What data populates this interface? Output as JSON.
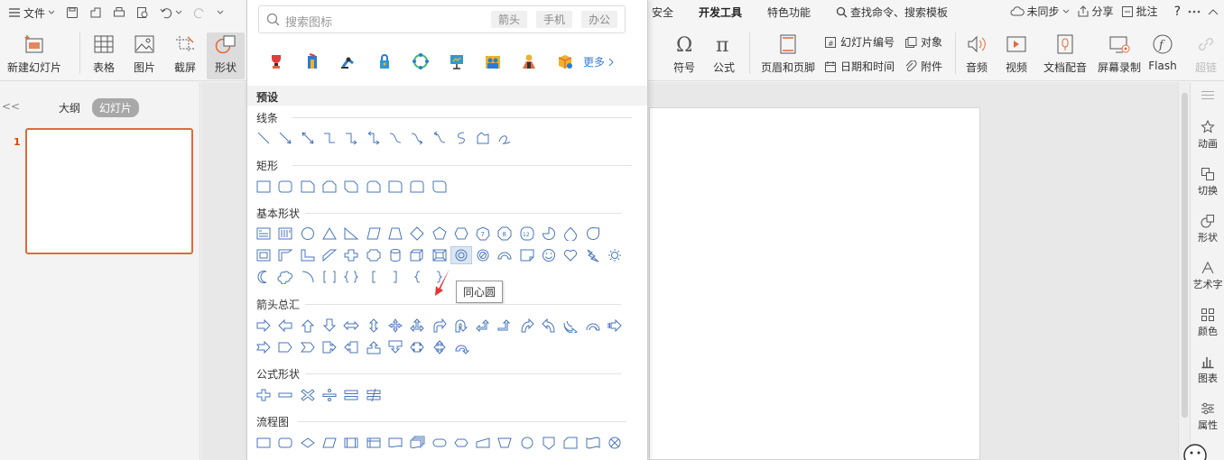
{
  "menubar": {
    "file_label": "文件",
    "tabs": [
      "安全",
      "开发工具",
      "特色功能"
    ],
    "active_tab": "开发工具",
    "search_label": "查找命令、搜索模板",
    "sync_label": "未同步",
    "share_label": "分享",
    "comment_label": "批注",
    "help_label": "?"
  },
  "ribbon": {
    "new_slide": "新建幻灯片",
    "table": "表格",
    "image": "图片",
    "screenshot": "截屏",
    "shape": "形状",
    "symbol": "符号",
    "formula": "公式",
    "header_footer": "页眉和页脚",
    "slide_number": "幻灯片编号",
    "object": "对象",
    "date_time": "日期和时间",
    "attachment": "附件",
    "audio": "音频",
    "video": "视频",
    "doc_audio": "文档配音",
    "screen_record": "屏幕录制",
    "flash": "Flash",
    "hyperlink": "超链"
  },
  "leftpanel": {
    "collapse": "<<",
    "outline_tab": "大纲",
    "slides_tab": "幻灯片",
    "slide_number": "1"
  },
  "sidebar": {
    "items": [
      "动画",
      "切换",
      "形状",
      "艺术字",
      "颜色",
      "图表",
      "属性"
    ]
  },
  "dropdown": {
    "search_placeholder": "搜索图标",
    "chips": [
      "箭头",
      "手机",
      "办公"
    ],
    "more_label": "更多",
    "preset_label": "预设",
    "categories": {
      "lines": "线条",
      "rect": "矩形",
      "basic": "基本形状",
      "arrows": "箭头总汇",
      "formula": "公式形状",
      "flowchart": "流程图"
    },
    "tooltip": "同心圆"
  },
  "colors": {
    "accent": "#e2693a",
    "shape_stroke": "#4a76b8",
    "link": "#3c7bd6"
  }
}
